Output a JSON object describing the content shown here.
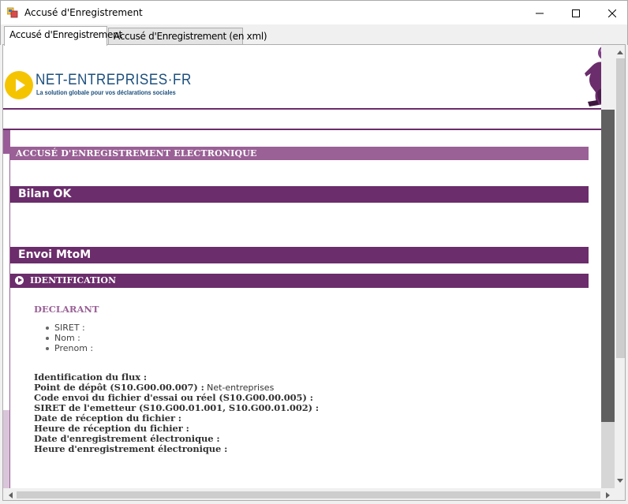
{
  "window": {
    "title": "Accusé d'Enregistrement"
  },
  "tabs": [
    {
      "label": "Accusé d'Enregistrement",
      "active": true
    },
    {
      "label": "Accusé d'Enregistrement (en xml)",
      "active": false
    }
  ],
  "header": {
    "brand": "NET-ENTREPRISES·FR",
    "tagline": "La solution globale pour vos déclarations sociales"
  },
  "sections": {
    "accuse_title": "ACCUSÉ D'ENREGISTREMENT ELECTRONIQUE",
    "bilan": "Bilan OK",
    "envoi": "Envoi MtoM",
    "identification": "IDENTIFICATION"
  },
  "declarant": {
    "heading": "DECLARANT",
    "items": [
      "SIRET :",
      "Nom :",
      "Prenom :"
    ]
  },
  "flux": [
    {
      "label": "Identification du flux :",
      "value": ""
    },
    {
      "label": "Point de dépôt (S10.G00.00.007) :",
      "value": "Net-entreprises"
    },
    {
      "label": "Code envoi du fichier d'essai ou réel (S10.G00.00.005) :",
      "value": ""
    },
    {
      "label": "SIRET de l'emetteur (S10.G00.01.001, S10.G00.01.002) :",
      "value": ""
    },
    {
      "label": "Date de réception du fichier :",
      "value": ""
    },
    {
      "label": "Heure de réception du fichier :",
      "value": ""
    },
    {
      "label": "Date d'enregistrement électronique :",
      "value": ""
    },
    {
      "label": "Heure d'enregistrement électronique :",
      "value": ""
    }
  ],
  "colors": {
    "brand_purple": "#6b2d6b",
    "light_purple": "#9a6196",
    "logo_yellow": "#f5c400",
    "logo_blue": "#1c4f7d"
  },
  "icons": [
    "app-icon",
    "minimize-icon",
    "maximize-icon",
    "close-icon",
    "play-logo-icon",
    "mascot-icon",
    "section-bullet-icon"
  ]
}
